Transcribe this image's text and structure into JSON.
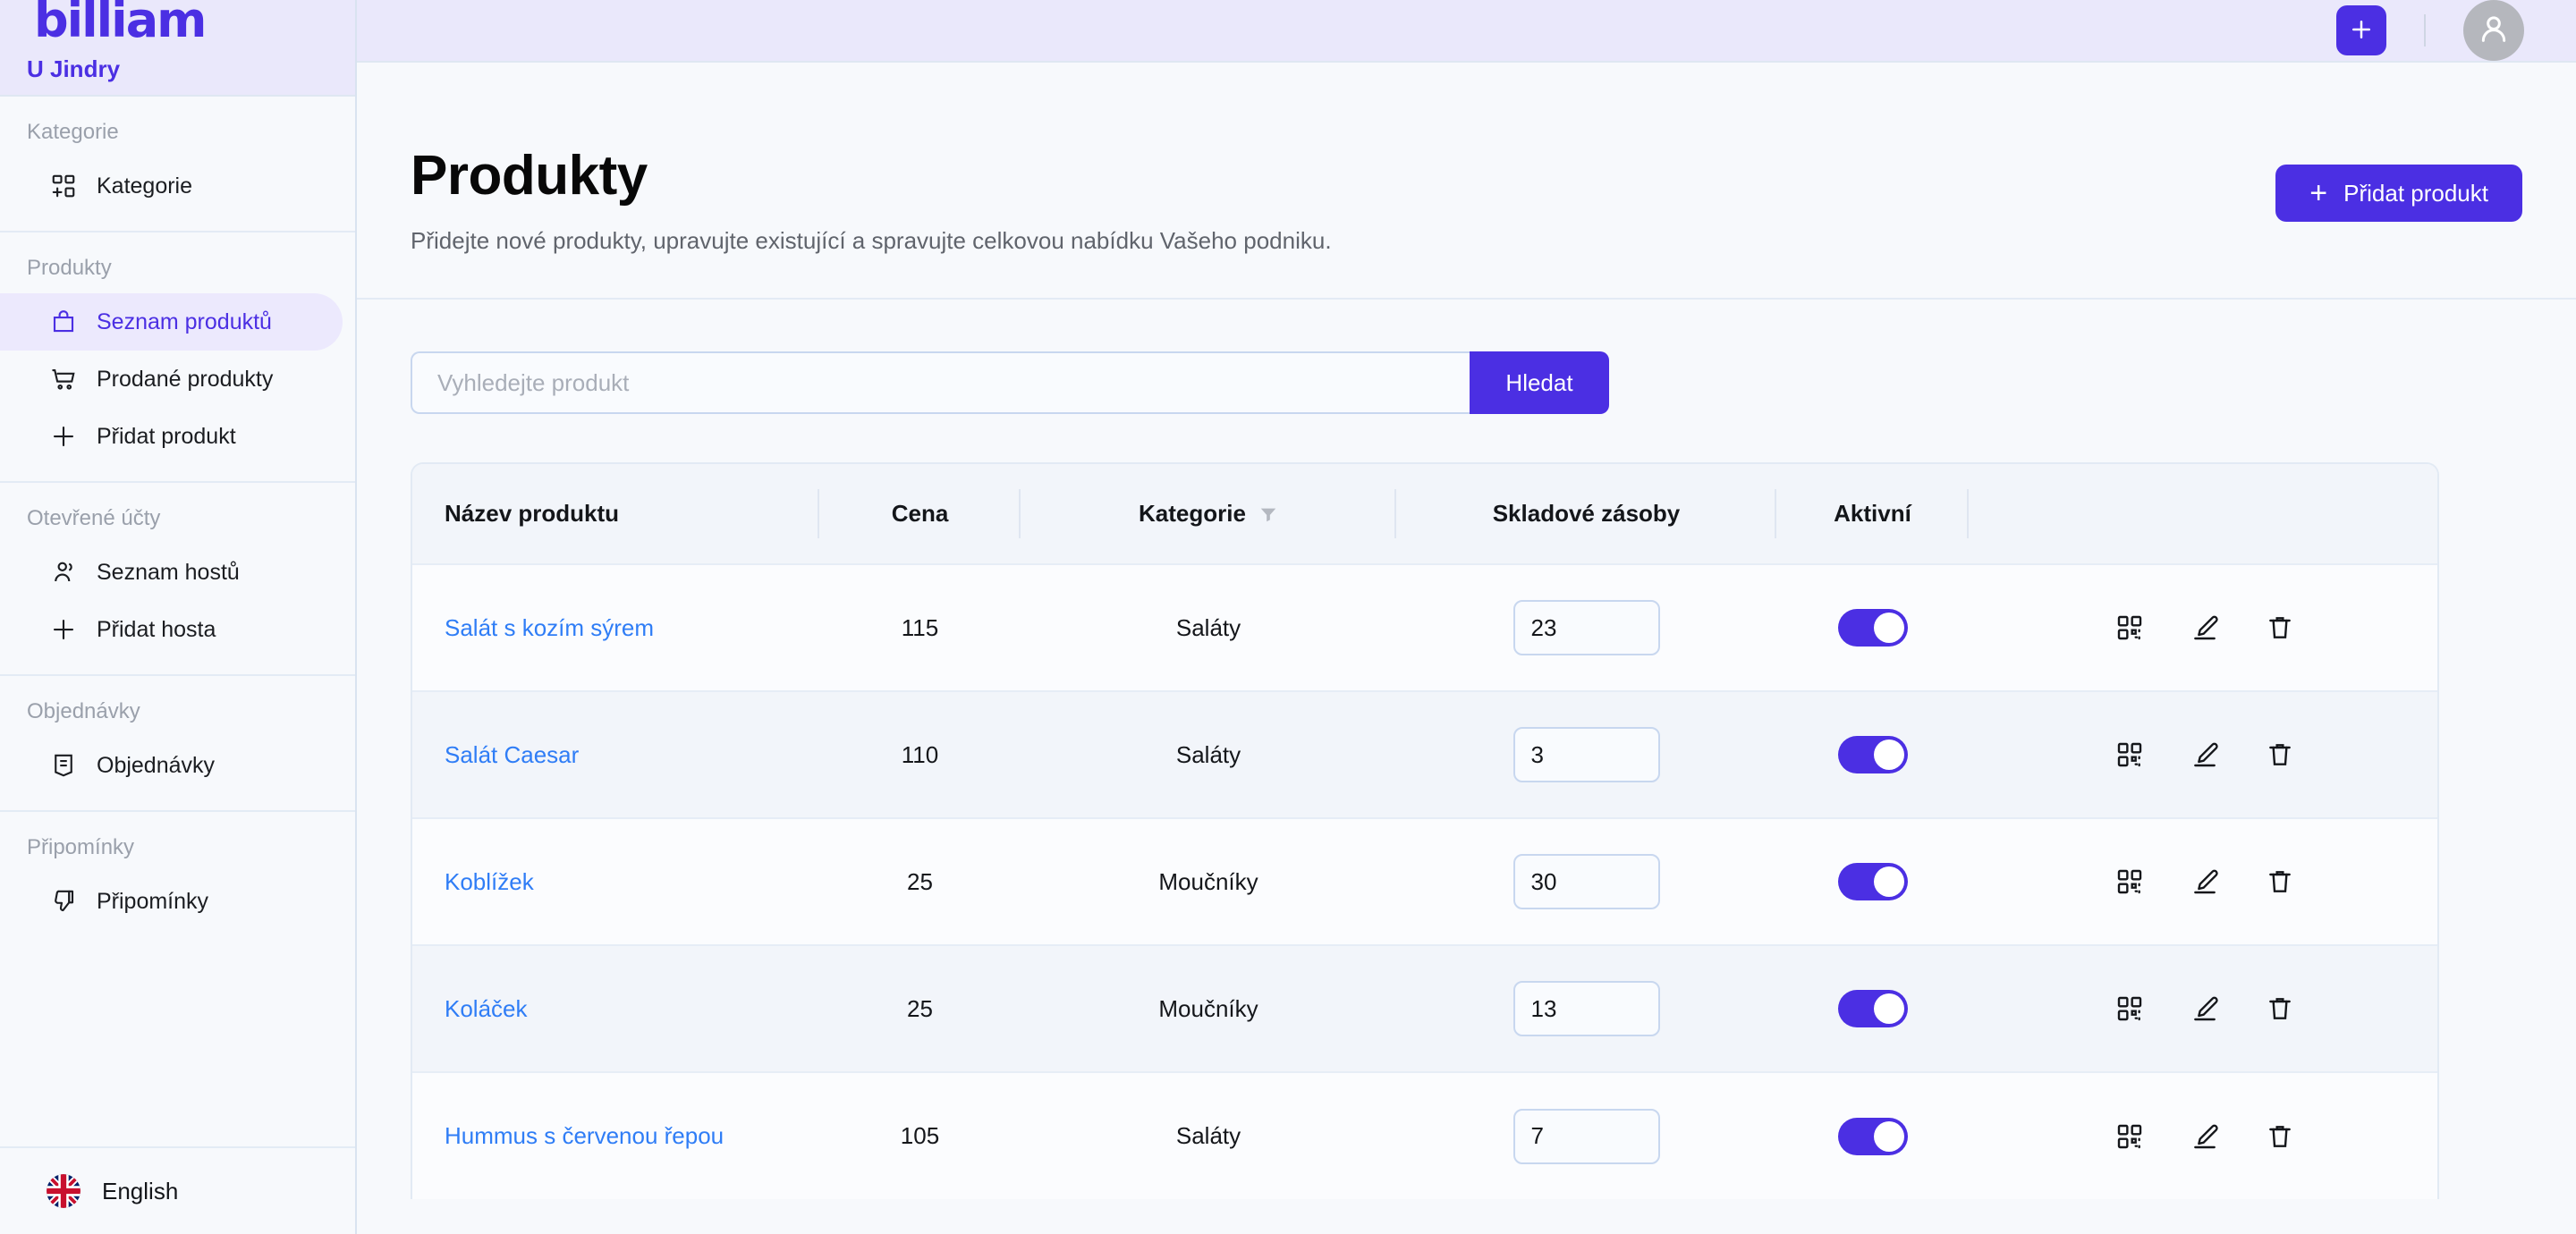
{
  "brand": {
    "logo_text": "billiam",
    "venue_name": "U Jindry"
  },
  "sidebar": {
    "groups": [
      {
        "label": "Kategorie",
        "items": [
          {
            "label": "Kategorie",
            "icon": "grid-plus-icon",
            "active": false
          }
        ]
      },
      {
        "label": "Produkty",
        "items": [
          {
            "label": "Seznam produktů",
            "icon": "bag-icon",
            "active": true
          },
          {
            "label": "Prodané produkty",
            "icon": "cart-icon",
            "active": false
          },
          {
            "label": "Přidat produkt",
            "icon": "plus-icon",
            "active": false
          }
        ]
      },
      {
        "label": "Otevřené účty",
        "items": [
          {
            "label": "Seznam hostů",
            "icon": "users-icon",
            "active": false
          },
          {
            "label": "Přidat hosta",
            "icon": "plus-icon",
            "active": false
          }
        ]
      },
      {
        "label": "Objednávky",
        "items": [
          {
            "label": "Objednávky",
            "icon": "receipt-icon",
            "active": false
          }
        ]
      },
      {
        "label": "Připomínky",
        "items": [
          {
            "label": "Připomínky",
            "icon": "thumbs-down-icon",
            "active": false
          }
        ]
      }
    ],
    "language": {
      "label": "English",
      "flag": "uk-flag-icon"
    }
  },
  "topbar": {
    "add_icon": "plus-icon",
    "avatar_icon": "user-avatar-icon"
  },
  "page": {
    "title": "Produkty",
    "subtitle": "Přidejte nové produkty, upravujte existující a spravujte celkovou nabídku Vašeho podniku.",
    "add_button": {
      "label": "Přidat produkt",
      "icon": "plus-icon"
    }
  },
  "search": {
    "placeholder": "Vyhledejte produkt",
    "value": "",
    "button_label": "Hledat"
  },
  "table": {
    "columns": [
      {
        "key": "name",
        "label": "Název produktu",
        "filter": false
      },
      {
        "key": "price",
        "label": "Cena",
        "filter": false
      },
      {
        "key": "category",
        "label": "Kategorie",
        "filter": true,
        "filter_icon": "funnel-icon"
      },
      {
        "key": "stock",
        "label": "Skladové zásoby",
        "filter": false
      },
      {
        "key": "active",
        "label": "Aktivní",
        "filter": false
      },
      {
        "key": "actions",
        "label": "",
        "filter": false
      }
    ],
    "rows": [
      {
        "name": "Salát s kozím sýrem",
        "price": "115",
        "category": "Saláty",
        "stock": "23",
        "active": true
      },
      {
        "name": "Salát Caesar",
        "price": "110",
        "category": "Saláty",
        "stock": "3",
        "active": true
      },
      {
        "name": "Koblížek",
        "price": "25",
        "category": "Moučníky",
        "stock": "30",
        "active": true
      },
      {
        "name": "Koláček",
        "price": "25",
        "category": "Moučníky",
        "stock": "13",
        "active": true
      },
      {
        "name": "Hummus s červenou řepou",
        "price": "105",
        "category": "Saláty",
        "stock": "7",
        "active": true
      }
    ],
    "row_actions": [
      {
        "name": "qr-code-icon",
        "title": "QR"
      },
      {
        "name": "edit-pencil-icon",
        "title": "Edit"
      },
      {
        "name": "trash-icon",
        "title": "Delete"
      }
    ]
  },
  "colors": {
    "accent": "#4b2fe3",
    "accent_soft": "#eae8fb",
    "link": "#2f7df6",
    "page_bg": "#f7f9fc",
    "row_alt": "#f2f5fa",
    "border": "#e2eaf4"
  }
}
